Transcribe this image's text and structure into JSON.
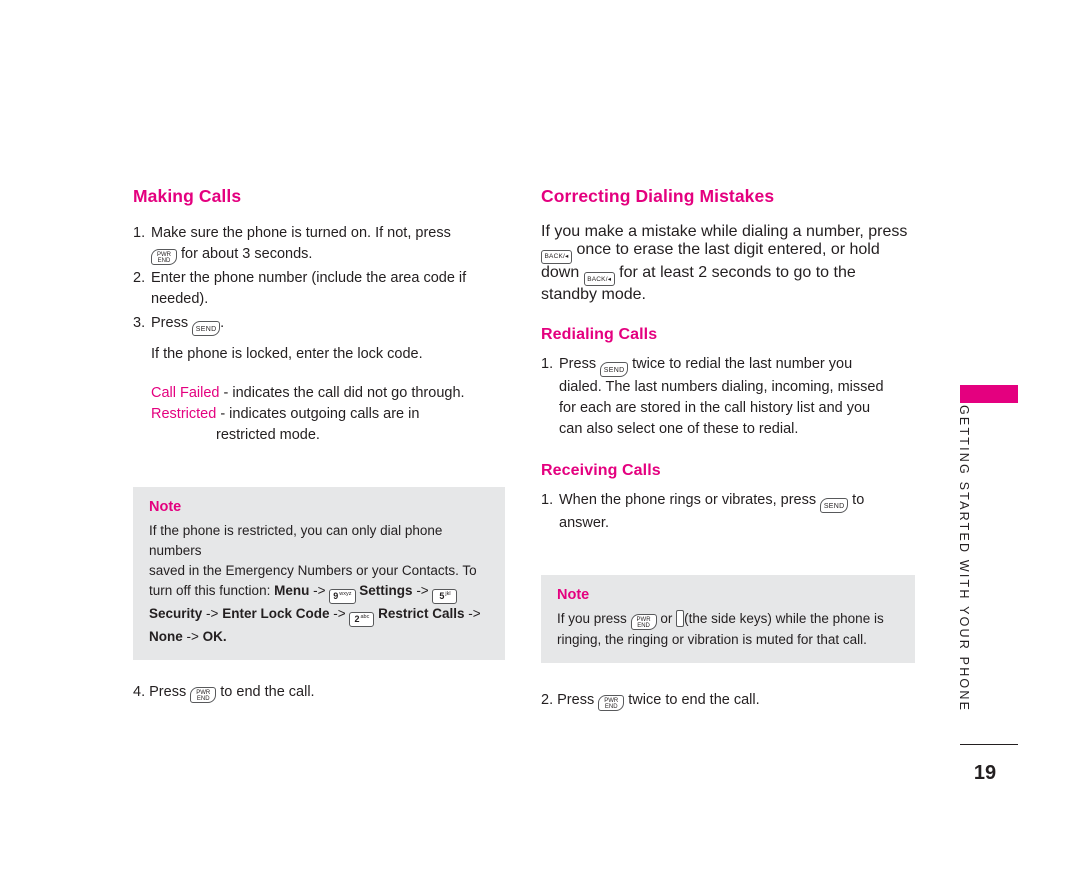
{
  "left_column": {
    "title": "Making Calls",
    "steps": [
      {
        "num": "1.",
        "text_before": "Make sure the phone is turned on. If not, press",
        "icon": "end-key-icon",
        "text_after": "for about 3 seconds."
      },
      {
        "num": "2.",
        "text_before": "Enter the phone number (include the area code if needed).",
        "icon": "",
        "text_after": ""
      },
      {
        "num": "3.",
        "text_before": "Press",
        "icon": "send-key-icon",
        "text_after": "."
      }
    ],
    "locked_note": "If the phone is locked, enter the lock code.",
    "call_failed_label": "Call Failed",
    "call_failed_text": "- indicates the call did not go through.",
    "restricted_label": "Restricted",
    "restricted_text": "- indicates outgoing calls are in",
    "restricted_text2": "restricted mode.",
    "note": {
      "title": "Note",
      "line1": "If the phone is restricted, you can only dial phone numbers",
      "line2": "saved in the Emergency Numbers or your Contacts. To",
      "line3_a": "turn off this function:",
      "line3_menu": "Menu",
      "line3_arrow": "->",
      "line3_key9": "9",
      "line3_key9_sup": "wxyz",
      "line3_settings": "Settings",
      "line3_key5": "5",
      "line3_key5_sup": "jkl",
      "line4_security": "Security",
      "line4_enter_lock": "Enter Lock Code",
      "line4_key2": "2",
      "line4_key2_sup": "abc",
      "line4_restrict": "Restrict Calls",
      "line5_none": "None",
      "line5_ok": "OK."
    },
    "step4": {
      "num": "4.",
      "text_before": "Press",
      "icon": "end-key-icon",
      "text_after": "to end the call."
    }
  },
  "right_column": {
    "title": "Correcting Dialing Mistakes",
    "intro_line1": "If you make a mistake while dialing a number, press",
    "intro_line2_after_icon": "once to erase the last digit entered, or hold",
    "intro_line3_before": "down",
    "intro_line3_after": "for at least 2 seconds to go to the",
    "intro_line4": "standby mode.",
    "redialing_title": "Redialing Calls",
    "redialing_step": {
      "num": "1.",
      "text_before": "Press",
      "icon": "send-key-icon",
      "text_after": "twice to redial the last number you",
      "line2": "dialed. The last numbers dialing, incoming, missed",
      "line3": "for each are stored in the call history list and you",
      "line4": "can also select one of these to redial."
    },
    "receiving_title": "Receiving Calls",
    "receiving_step": {
      "num": "1.",
      "text_before": "When the phone rings or vibrates, press",
      "icon": "send-key-icon",
      "text_after": "to",
      "line2": "answer."
    },
    "note": {
      "title": "Note",
      "line1_a": "If you press",
      "line1_or": "or",
      "line1_b": "(the side keys) while the phone is",
      "line2": "ringing, the ringing or vibration is muted for that call."
    },
    "step2": {
      "num": "2.",
      "text_before": "Press",
      "icon": "end-key-icon",
      "text_after": "twice to end the call."
    }
  },
  "side_tab": {
    "label": "GETTING STARTED WITH YOUR PHONE",
    "page_number": "19",
    "accent_color": "#e4007f"
  },
  "keys": {
    "send_label_top": "SEND",
    "end_label_top": "PWR",
    "end_label_bottom": "END",
    "back_label": "BACK/"
  }
}
